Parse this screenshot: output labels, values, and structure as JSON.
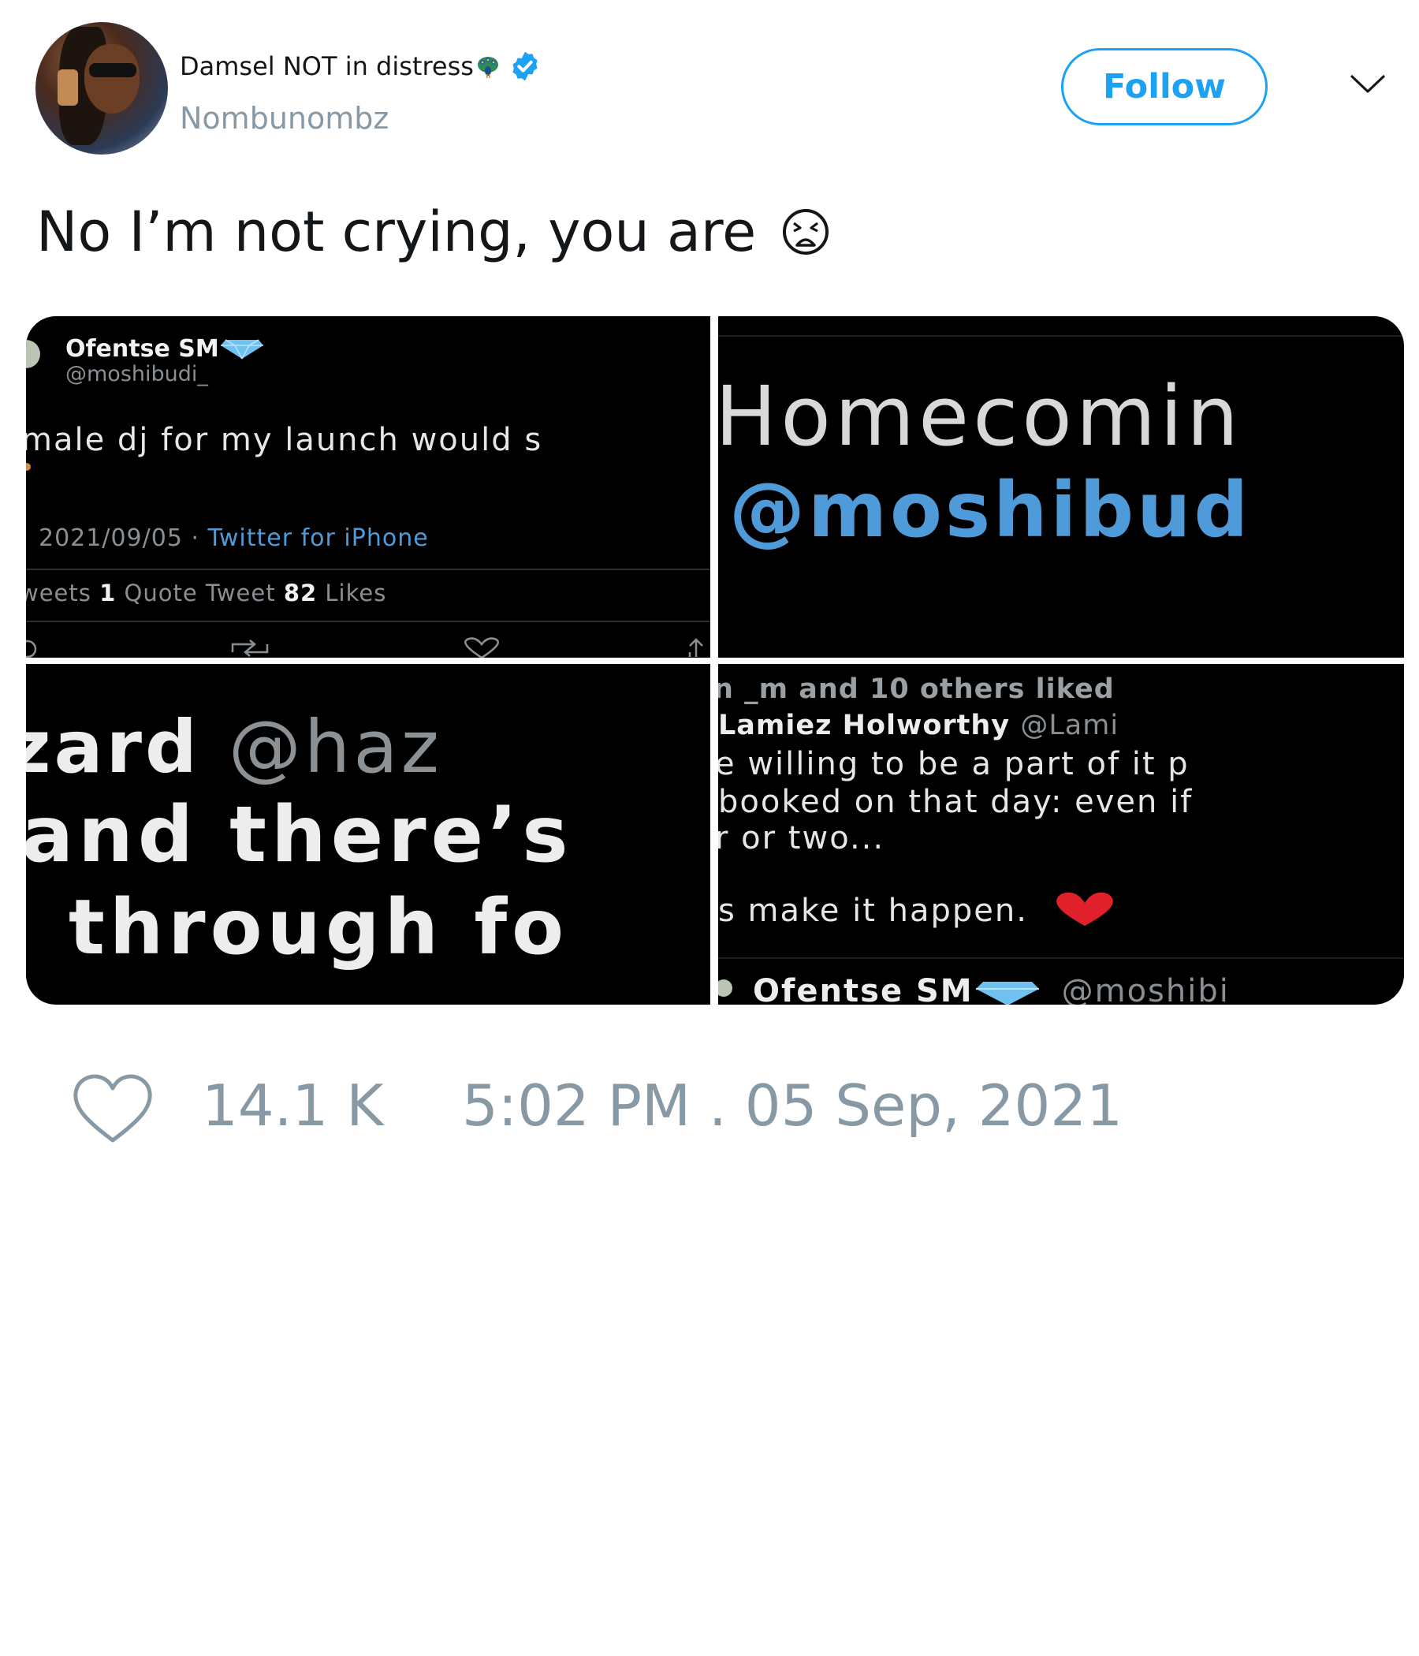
{
  "author": {
    "display_name": "Damsel NOT in distress",
    "handle": "Nombunombz",
    "verified": true
  },
  "actions": {
    "follow_label": "Follow"
  },
  "tweet": {
    "text": "No I’m not crying, you are"
  },
  "media": {
    "tile1": {
      "name": "Ofentse SM",
      "handle": "@moshibudi_",
      "line": "male dj for my launch would s",
      "meta_date": "2021/09/05 · ",
      "meta_source": "Twitter for iPhone",
      "stats_prefix": "weets ",
      "quote_count": "1",
      "quote_label": " Quote Tweet ",
      "likes_count": "82",
      "likes_label": " Likes"
    },
    "tile2": {
      "line1": "Homecomin",
      "line2": "@moshibud"
    },
    "tile3": {
      "line1a": "zard ",
      "line1b": "@haz",
      "line2": "and there’s",
      "line3": "through fo"
    },
    "tile4": {
      "liked_line": "n _m and 10 others liked",
      "author_name": "Lamiez Holworthy ",
      "author_handle": "@Lami",
      "body1": "e willing to be a part of it p",
      "body2": "booked on that day: even if",
      "body3": "r or two...",
      "body4": "s make it happen.",
      "footer_name": "Ofentse SM",
      "footer_handle": "@moshibi"
    }
  },
  "stats": {
    "likes": "14.1 K",
    "timestamp": "5:02 PM . 05 Sep, 2021"
  },
  "colors": {
    "accent": "#1da1f2",
    "muted": "#8899a6",
    "text": "#14171a",
    "tile_bg": "#000000",
    "link_blue": "#4f9bd9",
    "heart_red": "#e0202a"
  },
  "icons": [
    "peacock-icon",
    "verified-icon",
    "chevron-down-icon",
    "weary-face-icon",
    "diamond-icon",
    "red-heart-icon",
    "heart-icon"
  ]
}
